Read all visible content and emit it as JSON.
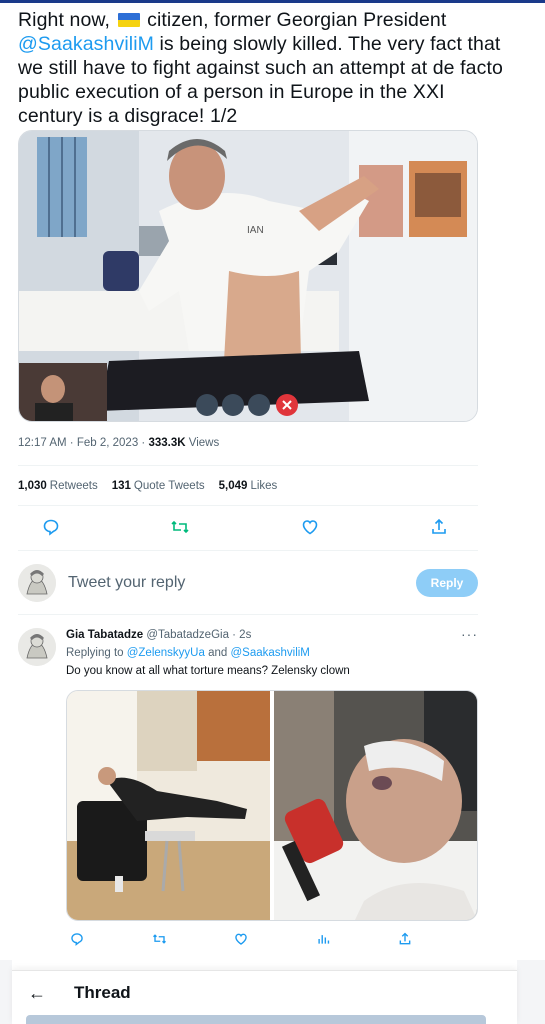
{
  "tweet": {
    "text_before_flag": "Right now, ",
    "flag_icon": "ukraine-flag-icon",
    "text_after_flag": " citizen, former Georgian President",
    "mention": "@SaakashviliM",
    "text_after_mention": " is being slowly killed. The very fact that we still have to fight against such an attempt at de facto public execution of a person in Europe in the XXI century is a disgrace! 1/2",
    "media": {
      "shirt_text": "IAN"
    },
    "time": "12:17 AM",
    "sep1": " · ",
    "date": "Feb 2, 2023",
    "sep2": " · ",
    "views_count": "333.3K",
    "views_label": " Views",
    "stats": {
      "retweets_count": "1,030",
      "retweets_label": "Retweets",
      "quotes_count": "131",
      "quotes_label": "Quote Tweets",
      "likes_count": "5,049",
      "likes_label": "Likes"
    },
    "actions": [
      "reply-icon",
      "retweet-icon",
      "like-icon",
      "share-icon"
    ]
  },
  "reply_box": {
    "placeholder": "Tweet your reply",
    "button_label": "Reply"
  },
  "reply": {
    "name": "Gia Tabatadze",
    "handle_time": " @TabatadzeGia · 2s",
    "replying_prefix": "Replying to ",
    "replying_mention_1": "@ZelenskyyUa",
    "replying_and": " and ",
    "replying_mention_2": "@SaakashviliM",
    "text": "Do you know at all what torture means? Zelensky clown",
    "more_label": "···",
    "actions": [
      "reply-icon",
      "retweet-icon",
      "like-icon",
      "views-icon",
      "share-icon"
    ]
  },
  "thread_bar": {
    "back_icon": "back-arrow-icon",
    "back_glyph": "←",
    "title": "Thread"
  },
  "colors": {
    "accent": "#1d9bf0",
    "retweet_green": "#00ba7c",
    "reply_button": "#8ecdf7",
    "muted_text": "#536471"
  }
}
